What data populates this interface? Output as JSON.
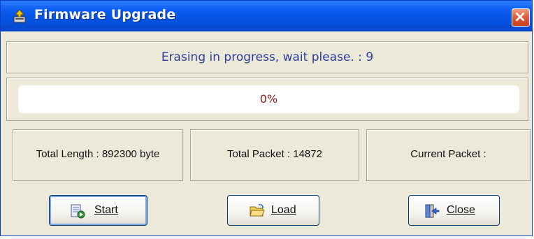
{
  "window": {
    "title": "Firmware Upgrade",
    "icon": "firmware-upgrade-icon",
    "close_icon": "close-icon"
  },
  "status": {
    "message": "Erasing in progress, wait please.  : 9"
  },
  "progress": {
    "value": 0,
    "label": "0%"
  },
  "info": {
    "total_length": "Total Length : 892300 byte",
    "total_packet": "Total Packet : 14872",
    "current_packet": "Current Packet :"
  },
  "buttons": {
    "start": {
      "label": "Start",
      "icon": "start-icon"
    },
    "load": {
      "label": "Load",
      "icon": "folder-open-icon"
    },
    "close": {
      "label": "Close",
      "icon": "exit-door-icon"
    }
  },
  "colors": {
    "titlebar": "#0a5ef0",
    "status_text": "#2b3fa0",
    "progress_text": "#8a1a1a",
    "close_button": "#e0603f"
  }
}
